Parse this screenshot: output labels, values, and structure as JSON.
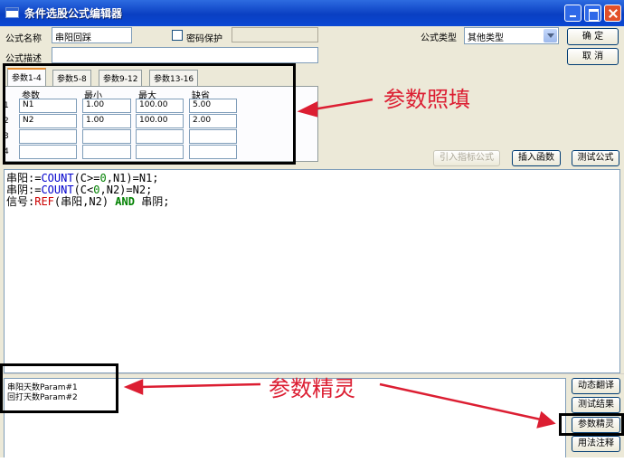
{
  "window": {
    "title": "条件选股公式编辑器"
  },
  "form": {
    "name_label": "公式名称",
    "name_value": "串阳回踩",
    "password_label": "密码保护",
    "desc_label": "公式描述",
    "desc_value": "",
    "type_label": "公式类型",
    "type_value": "其他类型"
  },
  "buttons": {
    "ok": "确  定",
    "cancel": "取  消",
    "import_indicator": "引入指标公式",
    "insert_function": "插入函数",
    "test_formula": "测试公式",
    "dynamic_translate": "动态翻译",
    "test_result": "测试结果",
    "param_wizard": "参数精灵",
    "usage_notes": "用法注释"
  },
  "param_tabs": [
    "参数1-4",
    "参数5-8",
    "参数9-12",
    "参数13-16"
  ],
  "param_table": {
    "headers": [
      "参数",
      "最小",
      "最大",
      "缺省"
    ],
    "row_numbers": [
      "1",
      "2",
      "3",
      "4"
    ],
    "rows": [
      [
        "N1",
        "1.00",
        "100.00",
        "5.00"
      ],
      [
        "N2",
        "1.00",
        "100.00",
        "2.00"
      ],
      [
        "",
        "",
        "",
        ""
      ],
      [
        "",
        "",
        "",
        ""
      ]
    ]
  },
  "code": {
    "line1": {
      "a": "串阳:=",
      "b": "COUNT",
      "c": "(C>=",
      "d": "0",
      "e": ",N1)=N1;"
    },
    "line2": {
      "a": "串阴:=",
      "b": "COUNT",
      "c": "(C<",
      "d": "0",
      "e": ",N2)=N2;"
    },
    "line3": {
      "a": "信号:",
      "b": "REF",
      "c": "(串阳,N2) ",
      "d": "AND",
      "e": " 串阴;"
    }
  },
  "param_hint": {
    "line1": "串阳天数Param#1",
    "line2": "回打天数Param#2"
  },
  "annotations": {
    "param_fill": "参数照填",
    "param_wizard": "参数精灵"
  },
  "colors": {
    "title_bar": "#0a3fc2",
    "annotation_red": "#dc1e32",
    "keyword_blue": "#0000cc",
    "number_green": "#008000"
  }
}
